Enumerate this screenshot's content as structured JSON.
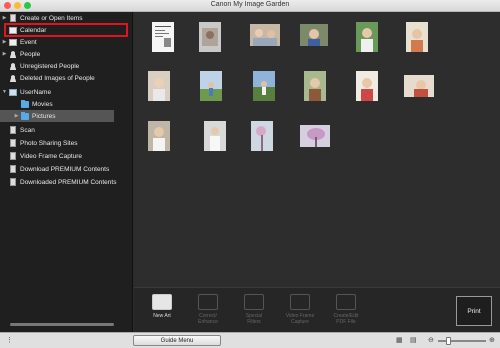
{
  "window": {
    "title": "Canon My Image Garden"
  },
  "sidebar": {
    "items": [
      {
        "label": "Create or Open Items",
        "icon": "create-icon",
        "expandable": true
      },
      {
        "label": "Calendar",
        "icon": "calendar-icon",
        "expandable": false
      },
      {
        "label": "Event",
        "icon": "event-icon",
        "expandable": true
      },
      {
        "label": "People",
        "icon": "people-icon",
        "expandable": true
      },
      {
        "label": "Unregistered People",
        "icon": "person-icon",
        "expandable": false
      },
      {
        "label": "Deleted Images of People",
        "icon": "person-icon",
        "expandable": false
      },
      {
        "label": "UserName",
        "icon": "monitor-icon",
        "expandable": true
      },
      {
        "label": "Movies",
        "icon": "folder-icon",
        "expandable": false
      },
      {
        "label": "Pictures",
        "icon": "folder-icon",
        "expandable": true,
        "selected": true
      },
      {
        "label": "Scan",
        "icon": "scan-icon",
        "expandable": false
      },
      {
        "label": "Photo Sharing Sites",
        "icon": "photo-sharing-icon",
        "expandable": false
      },
      {
        "label": "Video Frame Capture",
        "icon": "video-icon",
        "expandable": false
      },
      {
        "label": "Download PREMIUM Contents",
        "icon": "download-icon",
        "expandable": false
      },
      {
        "label": "Downloaded PREMIUM Contents",
        "icon": "downloaded-icon",
        "expandable": false
      }
    ]
  },
  "toolbar": {
    "tools": [
      {
        "label_line1": "New Art",
        "label_line2": "",
        "active": true
      },
      {
        "label_line1": "Correct/",
        "label_line2": "Enhance",
        "active": false
      },
      {
        "label_line1": "Special",
        "label_line2": "Filters",
        "active": false
      },
      {
        "label_line1": "Video Frame",
        "label_line2": "Capture",
        "active": false
      },
      {
        "label_line1": "Create/Edit",
        "label_line2": "PDF File",
        "active": false
      }
    ],
    "print_label": "Print"
  },
  "statusbar": {
    "guide_menu_label": "Guide Menu"
  },
  "colors": {
    "highlight": "#e0141c",
    "selected_row": "#555555"
  }
}
